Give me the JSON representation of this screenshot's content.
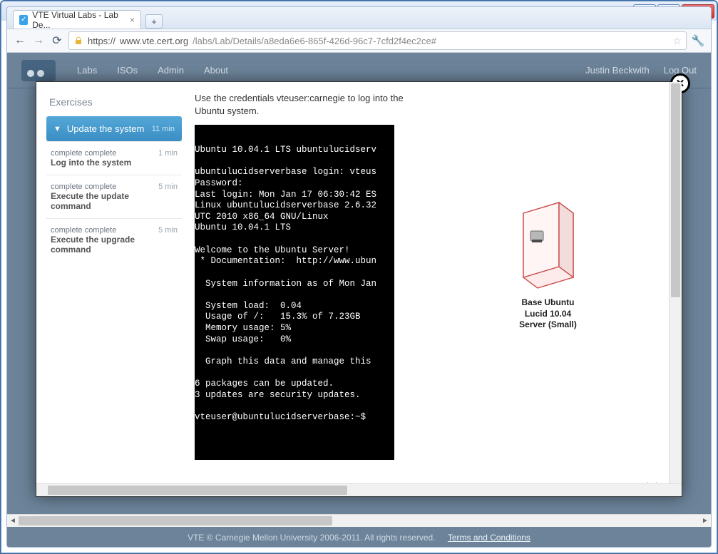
{
  "window": {
    "tab_title": "VTE Virtual Labs - Lab De..."
  },
  "browser": {
    "url_scheme": "https://",
    "url_host": "www.vte.cert.org",
    "url_path": "/labs/Lab/Details/a8eda6e6-865f-426d-96c7-7cfd2f4ec2ce#"
  },
  "site": {
    "nav": {
      "labs": "Labs",
      "isos": "ISOs",
      "admin": "Admin",
      "about": "About"
    },
    "user_name": "Justin Beckwith",
    "logout": "Log Out",
    "footer_text": "VTE © Carnegie Mellon University 2006-2011. All rights reserved.",
    "footer_link": "Terms and Conditions"
  },
  "sidebar": {
    "heading": "Exercises",
    "active": {
      "caret": "▼",
      "label": "Update the system",
      "duration": "11 min"
    },
    "items": [
      {
        "status": "complete complete",
        "title": "Log into the system",
        "duration": "1 min"
      },
      {
        "status": "complete complete",
        "title": "Execute the update command",
        "duration": "5 min"
      },
      {
        "status": "complete complete",
        "title": "Execute the upgrade command",
        "duration": "5 min"
      }
    ]
  },
  "instruction": "Use the credentials vteuser:carnegie to log into the Ubuntu system.",
  "terminal_text": "\nUbuntu 10.04.1 LTS ubuntulucidserv\n\nubuntulucidserverbase login: vteus\nPassword:\nLast login: Mon Jan 17 06:30:42 ES\nLinux ubuntulucidserverbase 2.6.32\nUTC 2010 x86_64 GNU/Linux\nUbuntu 10.04.1 LTS\n\nWelcome to the Ubuntu Server!\n * Documentation:  http://www.ubun\n\n  System information as of Mon Jan\n\n  System load:  0.04\n  Usage of /:   15.3% of 7.23GB\n  Memory usage: 5%\n  Swap usage:   0%\n\n  Graph this data and manage this\n\n6 packages can be updated.\n3 updates are security updates.\n\nvteuser@ubuntulucidserverbase:~$",
  "vm": {
    "label_line1": "Base Ubuntu",
    "label_line2": "Lucid 10.04",
    "label_line3": "Server (Small)"
  }
}
